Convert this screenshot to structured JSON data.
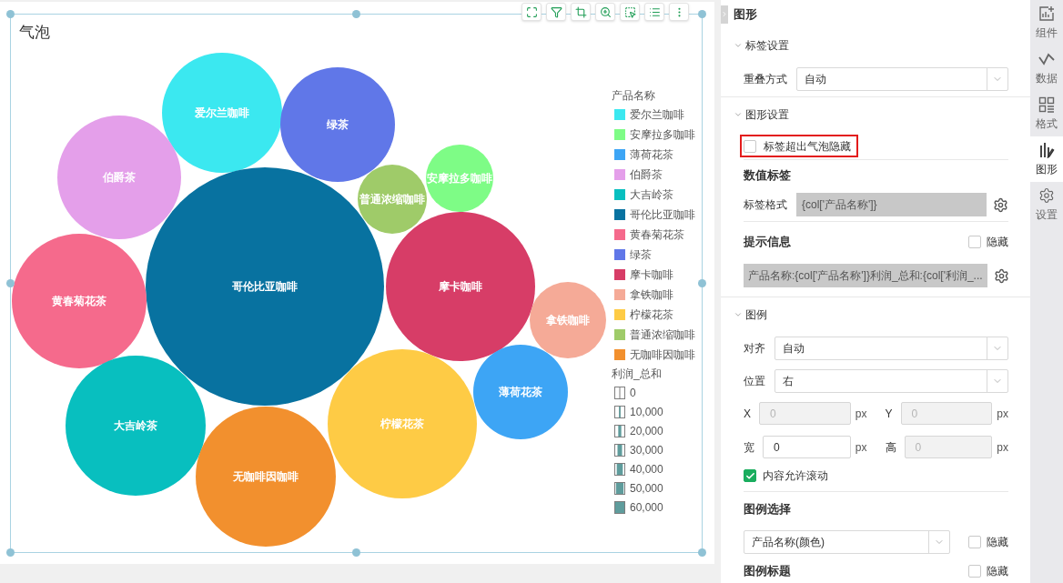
{
  "chart": {
    "title": "气泡",
    "bubbles": [
      {
        "label": "爱尔兰咖啡",
        "color": "#3be8f0"
      },
      {
        "label": "绿茶",
        "color": "#6077e8"
      },
      {
        "label": "伯爵茶",
        "color": "#e49fea"
      },
      {
        "label": "普通浓缩咖啡",
        "color": "#9fcb69"
      },
      {
        "label": "安摩拉多咖啡",
        "color": "#7efc86"
      },
      {
        "label": "哥伦比亚咖啡",
        "color": "#0872a0"
      },
      {
        "label": "黄春菊花茶",
        "color": "#f56a8c"
      },
      {
        "label": "摩卡咖啡",
        "color": "#d73d67"
      },
      {
        "label": "拿铁咖啡",
        "color": "#f5aa97"
      },
      {
        "label": "薄荷花茶",
        "color": "#3da5f5"
      },
      {
        "label": "大吉岭茶",
        "color": "#08bfbf"
      },
      {
        "label": "柠檬花茶",
        "color": "#fecb45"
      },
      {
        "label": "无咖啡因咖啡",
        "color": "#f2902e"
      }
    ],
    "legend": {
      "title": "产品名称",
      "items": [
        {
          "label": "爱尔兰咖啡",
          "color": "#3be8f0"
        },
        {
          "label": "安摩拉多咖啡",
          "color": "#7efc86"
        },
        {
          "label": "薄荷花茶",
          "color": "#3da5f5"
        },
        {
          "label": "伯爵茶",
          "color": "#e49fea"
        },
        {
          "label": "大吉岭茶",
          "color": "#08bfbf"
        },
        {
          "label": "哥伦比亚咖啡",
          "color": "#0872a0"
        },
        {
          "label": "黄春菊花茶",
          "color": "#f56a8c"
        },
        {
          "label": "绿茶",
          "color": "#6077e8"
        },
        {
          "label": "摩卡咖啡",
          "color": "#d73d67"
        },
        {
          "label": "拿铁咖啡",
          "color": "#f5aa97"
        },
        {
          "label": "柠檬花茶",
          "color": "#fecb45"
        },
        {
          "label": "普通浓缩咖啡",
          "color": "#9fcb69"
        },
        {
          "label": "无咖啡因咖啡",
          "color": "#f2902e"
        }
      ],
      "size_title": "利润_总和",
      "size_items": [
        {
          "label": "0"
        },
        {
          "label": "10,000"
        },
        {
          "label": "20,000"
        },
        {
          "label": "30,000"
        },
        {
          "label": "40,000"
        },
        {
          "label": "50,000"
        },
        {
          "label": "60,000"
        }
      ]
    }
  },
  "panel": {
    "title": "图形",
    "label_settings": {
      "heading": "标签设置",
      "expanded": true,
      "overlap": {
        "label": "重叠方式",
        "value": "自动"
      }
    },
    "shape_settings": {
      "heading": "图形设置",
      "expanded": true,
      "hide_overflow": {
        "label": "标签超出气泡隐藏",
        "checked": false,
        "highlighted": true
      },
      "value_label": {
        "heading": "数值标签",
        "format_label": "标签格式",
        "format_value": "{col['产品名称']}"
      },
      "tooltip": {
        "heading": "提示信息",
        "hide_label": "隐藏",
        "hide_checked": false,
        "value": "产品名称:{col['产品名称']}利润_总和:{col['利润_..."
      }
    },
    "legend": {
      "heading": "图例",
      "expanded": true,
      "align": {
        "label": "对齐",
        "value": "自动"
      },
      "position": {
        "label": "位置",
        "value": "右"
      },
      "offset": [
        {
          "label": "X",
          "value": "0",
          "unit": "px",
          "disabled": true
        },
        {
          "label": "Y",
          "value": "0",
          "unit": "px",
          "disabled": true
        }
      ],
      "size": [
        {
          "label": "宽",
          "value": "0",
          "unit": "px",
          "disabled": false
        },
        {
          "label": "高",
          "value": "0",
          "unit": "px",
          "disabled": true
        }
      ],
      "scroll": {
        "label": "内容允许滚动",
        "checked": true
      },
      "selection": {
        "heading": "图例选择",
        "value": "产品名称(颜色)",
        "hide_label": "隐藏",
        "hide_checked": false
      },
      "legend_title": {
        "heading": "图例标题",
        "hide_label": "隐藏",
        "hide_checked": false
      }
    }
  },
  "side_tabs": [
    {
      "label": "组件",
      "selected": false
    },
    {
      "label": "数据",
      "selected": false
    },
    {
      "label": "格式",
      "selected": false
    },
    {
      "label": "图形",
      "selected": true
    },
    {
      "label": "设置",
      "selected": false
    }
  ]
}
